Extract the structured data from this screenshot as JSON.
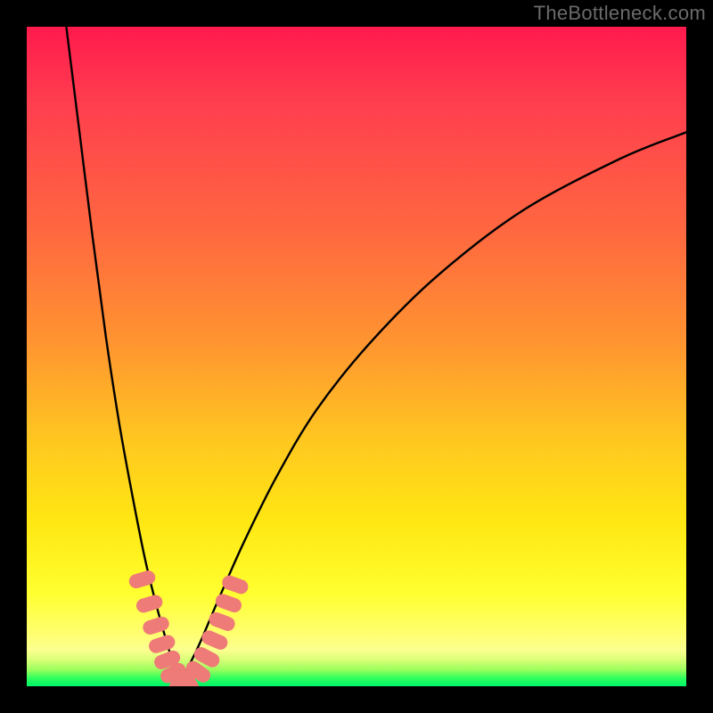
{
  "watermark": "TheBottleneck.com",
  "colors": {
    "bg_black": "#000000",
    "curve_stroke": "#000000",
    "marker_fill": "#ee7b77",
    "gradient": [
      "#ff1a4d",
      "#ff6a3f",
      "#ffc820",
      "#ffff30",
      "#00f56a"
    ]
  },
  "chart_data": {
    "type": "line",
    "title": "",
    "xlabel": "",
    "ylabel": "",
    "xlim": [
      0,
      100
    ],
    "ylim": [
      0,
      100
    ],
    "grid": false,
    "legend": false,
    "notes": "V-shaped bottleneck curve; trough near x≈23 at y≈0; steep left wall, gentler right wall; background is red→yellow→green vertical gradient indicating bottleneck severity by y.",
    "series": [
      {
        "name": "left-branch",
        "x": [
          6,
          8,
          10,
          12,
          14,
          16,
          18,
          20,
          22,
          23
        ],
        "y": [
          100,
          84,
          68,
          53,
          40,
          29,
          19,
          11,
          4,
          0
        ]
      },
      {
        "name": "right-branch",
        "x": [
          23,
          26,
          29,
          33,
          38,
          44,
          52,
          62,
          75,
          90,
          100
        ],
        "y": [
          0,
          6,
          13,
          22,
          32,
          42,
          52,
          62,
          72,
          80,
          84
        ]
      }
    ],
    "markers": {
      "name": "highlighted-segment",
      "shape": "rounded-rect",
      "color": "#ee7b77",
      "points_xy": [
        [
          17.5,
          16.2
        ],
        [
          18.6,
          12.5
        ],
        [
          19.6,
          9.2
        ],
        [
          20.5,
          6.4
        ],
        [
          21.3,
          4.0
        ],
        [
          22.2,
          2.0
        ],
        [
          23.1,
          0.6
        ],
        [
          24.6,
          0.6
        ],
        [
          26.0,
          2.2
        ],
        [
          27.3,
          4.4
        ],
        [
          28.5,
          7.0
        ],
        [
          29.6,
          9.8
        ],
        [
          30.6,
          12.6
        ],
        [
          31.6,
          15.4
        ]
      ]
    }
  }
}
